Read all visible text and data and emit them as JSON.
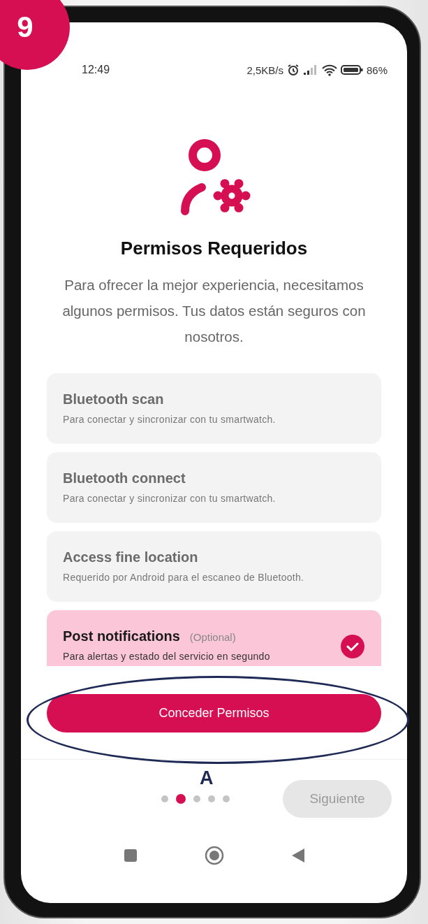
{
  "annotations": {
    "step": "9",
    "callout": "A"
  },
  "status_bar": {
    "time": "12:49",
    "speed": "2,5KB/s",
    "battery": "86%"
  },
  "title": "Permisos Requeridos",
  "description": "Para ofrecer la mejor experiencia, necesitamos algunos permisos. Tus datos están seguros con nosotros.",
  "permissions": [
    {
      "title": "Bluetooth scan",
      "description": "Para conectar y sincronizar con tu smartwatch.",
      "checked": false
    },
    {
      "title": "Bluetooth connect",
      "description": "Para conectar y sincronizar con tu smartwatch.",
      "checked": false
    },
    {
      "title": "Access fine location",
      "description": "Requerido por Android para el escaneo de Bluetooth.",
      "checked": false
    },
    {
      "title": "Post notifications",
      "tag": "(Optional)",
      "description": "Para alertas y estado del servicio en segundo",
      "checked": true
    }
  ],
  "grant_button": "Conceder Permisos",
  "pager": [
    {
      "selected": false
    },
    {
      "selected": true
    },
    {
      "selected": false
    },
    {
      "selected": false
    },
    {
      "selected": false
    }
  ],
  "next_button": {
    "label": "Siguiente",
    "disabled": true
  }
}
